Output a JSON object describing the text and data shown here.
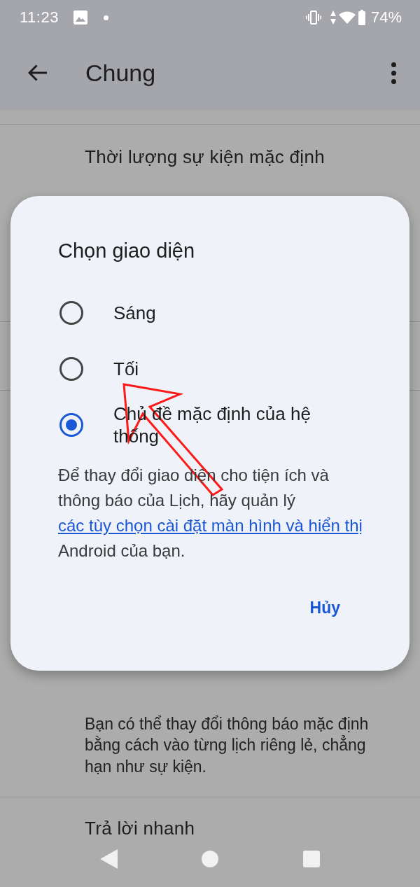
{
  "status_bar": {
    "time": "11:23",
    "battery": "74%"
  },
  "app_bar": {
    "title": "Chung"
  },
  "settings": {
    "above_dialog": [
      {
        "kind": "item",
        "title": "Thời lượng sự kiện mặc định"
      }
    ],
    "below_dialog": [
      {
        "kind": "note",
        "text": "Bạn có thể thay đổi thông báo mặc định bằng cách vào từng lịch riêng lẻ, chẳng hạn như sự kiện."
      },
      {
        "kind": "item",
        "title": "Trả lời nhanh"
      }
    ]
  },
  "dialog": {
    "title": "Chọn giao diện",
    "options": [
      {
        "label": "Sáng",
        "selected": false
      },
      {
        "label": "Tối",
        "selected": false
      },
      {
        "label": "Chủ đề mặc định của hệ thống",
        "selected": true
      }
    ],
    "description": {
      "text": "Để thay đổi giao diện cho tiện ích và thông báo của Lịch, hãy quản lý",
      "link": "các tùy chọn cài đặt màn hình và hiển thị",
      "after": "Android của bạn."
    },
    "buttons": [
      "Hủy"
    ]
  },
  "annotation": {
    "kind": "arrow"
  }
}
